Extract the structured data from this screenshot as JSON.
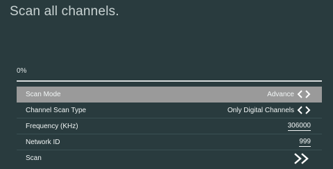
{
  "screen": {
    "title": "Scan all channels."
  },
  "progress": {
    "label": "0%",
    "value": 0
  },
  "menu": {
    "items": [
      {
        "label": "Scan Mode",
        "value": "Advance",
        "control": "left-right-arrows"
      },
      {
        "label": "Channel Scan Type",
        "value": "Only Digital Channels",
        "control": "left-right-arrows"
      },
      {
        "label": "Frequency (KHz)",
        "value": "306000",
        "control": "editable-number"
      },
      {
        "label": "Network ID",
        "value": "999",
        "control": "editable-number"
      },
      {
        "label": "Scan",
        "value": "",
        "control": "double-chevron-right"
      }
    ]
  },
  "colors": {
    "background": "#293b3e",
    "selected_row": "#9a9a9a",
    "text": "#f1f5f5"
  }
}
